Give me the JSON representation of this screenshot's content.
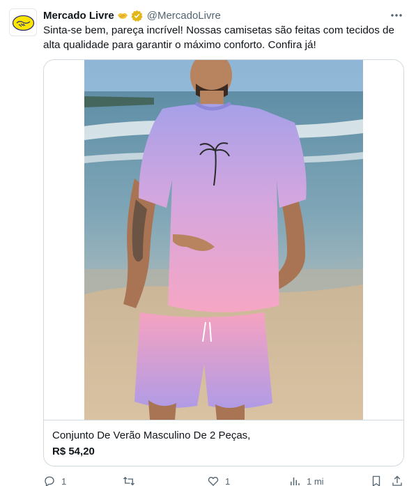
{
  "tweet": {
    "author_name": "Mercado Livre",
    "author_handle": "@MercadoLivre",
    "text": "Sinta-se bem, pareça incrível! Nossas camisetas são feitas com tecidos de alta qualidade para garantir o máximo conforto. Confira já!",
    "more_icon": "more-horizontal-icon"
  },
  "product_card": {
    "title": "Conjunto De Verão Masculino De 2 Peças,",
    "price": "R$ 54,20"
  },
  "actions": {
    "reply_count": "1",
    "retweet_count": "",
    "like_count": "1",
    "views_count": "1 mi"
  },
  "colors": {
    "verified_badge": "#e2b719",
    "text_primary": "#0f1419",
    "text_secondary": "#536471",
    "border": "#cfd9de"
  }
}
